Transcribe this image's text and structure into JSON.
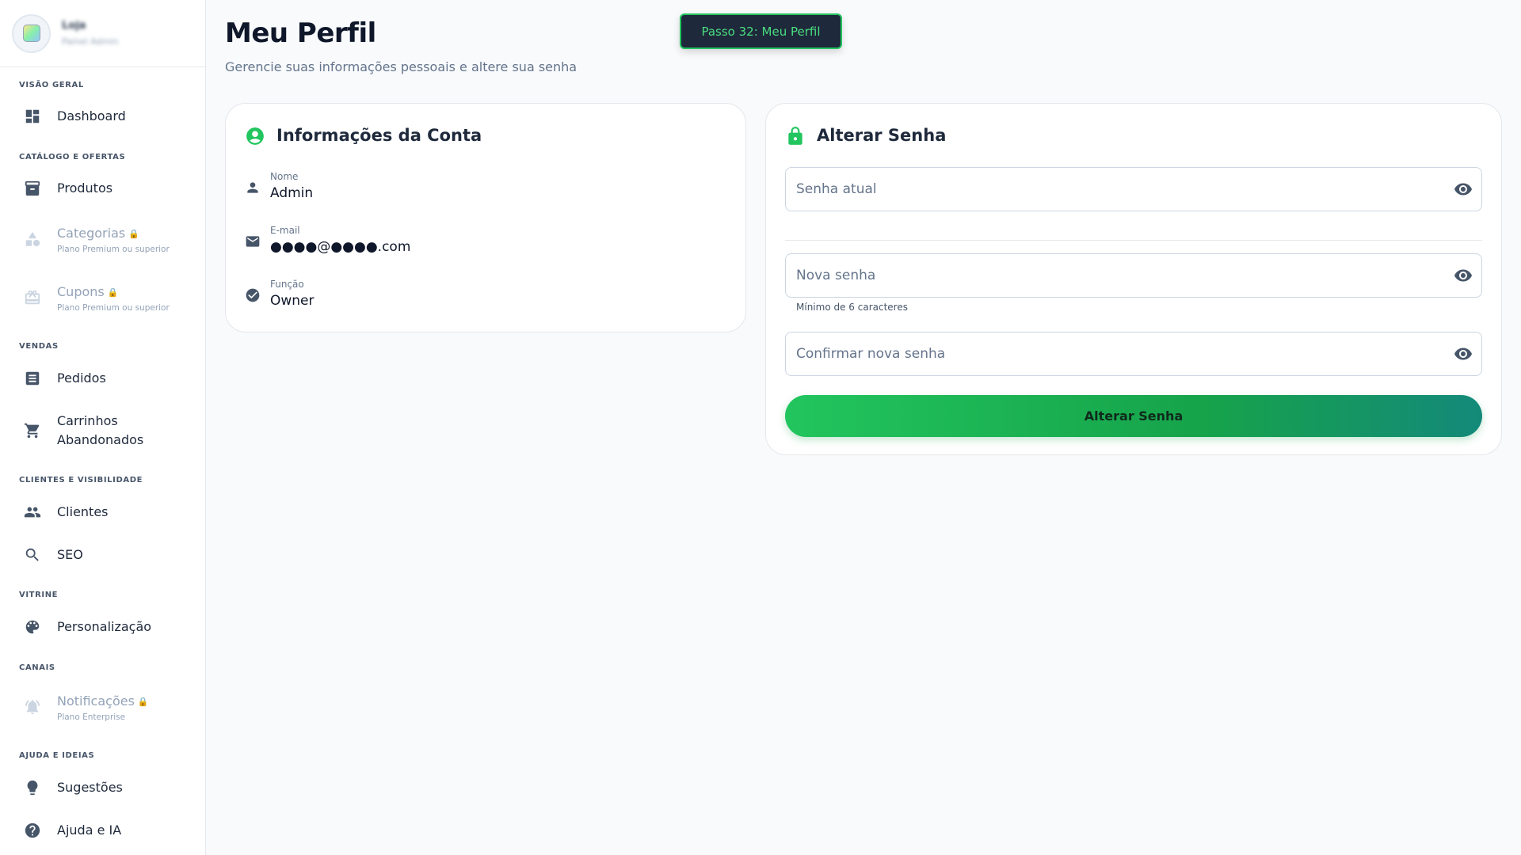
{
  "sidebar": {
    "store_name": "Loja",
    "store_sub": "Painel Admin",
    "sections": {
      "overview": "VISÃO GERAL",
      "catalog": "CATÁLOGO E OFERTAS",
      "sales": "VENDAS",
      "clients": "CLIENTES E VISIBILIDADE",
      "showcase": "VITRINE",
      "channels": "CANAIS",
      "help": "AJUDA E IDEIAS"
    },
    "items": {
      "dashboard": "Dashboard",
      "products": "Produtos",
      "categories": {
        "label": "Categorias",
        "sub": "Plano Premium ou superior"
      },
      "coupons": {
        "label": "Cupons",
        "sub": "Plano Premium ou superior"
      },
      "orders": "Pedidos",
      "abandoned_line1": "Carrinhos",
      "abandoned_line2": "Abandonados",
      "customers": "Clientes",
      "seo": "SEO",
      "customization": "Personalização",
      "notifications": {
        "label": "Notificações",
        "sub": "Plano Enterprise"
      },
      "suggestions": "Sugestões",
      "help_ai": "Ajuda e IA"
    },
    "lock_glyph": "🔒"
  },
  "header": {
    "title": "Meu Perfil",
    "subtitle": "Gerencie suas informações pessoais e altere sua senha",
    "step_badge": "Passo 32: Meu Perfil"
  },
  "account": {
    "title": "Informações da Conta",
    "fields": [
      {
        "label": "Nome",
        "value": "Admin",
        "icon": "person-icon"
      },
      {
        "label": "E-mail",
        "value": "●●●●@●●●●.com",
        "icon": "mail-icon"
      },
      {
        "label": "Função",
        "value": "Owner",
        "icon": "check-circle-icon"
      }
    ]
  },
  "password": {
    "title": "Alterar Senha",
    "current_placeholder": "Senha atual",
    "new_placeholder": "Nova senha",
    "new_hint": "Mínimo de 6 caracteres",
    "confirm_placeholder": "Confirmar nova senha",
    "submit_label": "Alterar Senha"
  },
  "colors": {
    "accent": "#22c55e",
    "lock_badge": "#fb923c",
    "step_bg": "#1e293b"
  }
}
